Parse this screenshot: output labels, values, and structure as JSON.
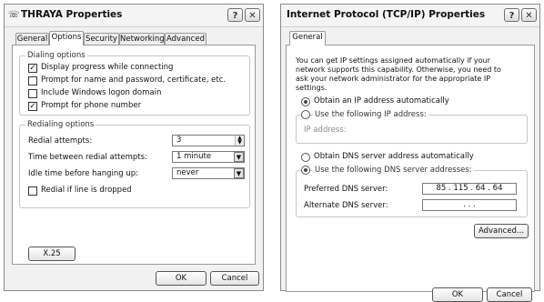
{
  "left_dialog": {
    "title": "THRAYA Properties",
    "help_glyph": "?",
    "close_glyph": "✕",
    "tabs": [
      "General",
      "Options",
      "Security",
      "Networking",
      "Advanced"
    ],
    "active_tab": "Options",
    "dialing_options": {
      "label": "Dialing options",
      "items": [
        {
          "label": "Display progress while connecting",
          "checked": true
        },
        {
          "label": "Prompt for name and password, certificate, etc.",
          "checked": false
        },
        {
          "label": "Include Windows logon domain",
          "checked": false
        },
        {
          "label": "Prompt for phone number",
          "checked": true
        }
      ]
    },
    "redialing_options": {
      "label": "Redialing options",
      "redial_attempts_label": "Redial attempts:",
      "redial_attempts_value": "3",
      "time_between_label": "Time between redial attempts:",
      "time_between_value": "1 minute",
      "idle_time_label": "Idle time before hanging up:",
      "idle_time_value": "never",
      "redial_if_dropped_label": "Redial if line is dropped",
      "redial_if_dropped_checked": false
    },
    "x25_button": "X.25",
    "ok_button": "OK",
    "cancel_button": "Cancel"
  },
  "right_dialog": {
    "title": "Internet Protocol (TCP/IP) Properties",
    "help_glyph": "?",
    "close_glyph": "✕",
    "tabs": [
      "General"
    ],
    "description": "You can get IP settings assigned automatically if your network supports this capability. Otherwise, you need to ask your network administrator for the appropriate IP settings.",
    "obtain_ip_auto": "Obtain an IP address automatically",
    "use_following_ip": "Use the following IP address:",
    "ip_address_label": "IP address:",
    "obtain_dns_auto": "Obtain DNS server address automatically",
    "use_following_dns": "Use the following DNS server addresses:",
    "preferred_dns_label": "Preferred DNS server:",
    "preferred_dns_value": "85 . 115 . 64 . 64",
    "alternate_dns_label": "Alternate DNS server:",
    "alternate_dns_value": ".     .     .",
    "advanced_button": "Advanced...",
    "ok_button": "OK",
    "cancel_button": "Cancel"
  }
}
